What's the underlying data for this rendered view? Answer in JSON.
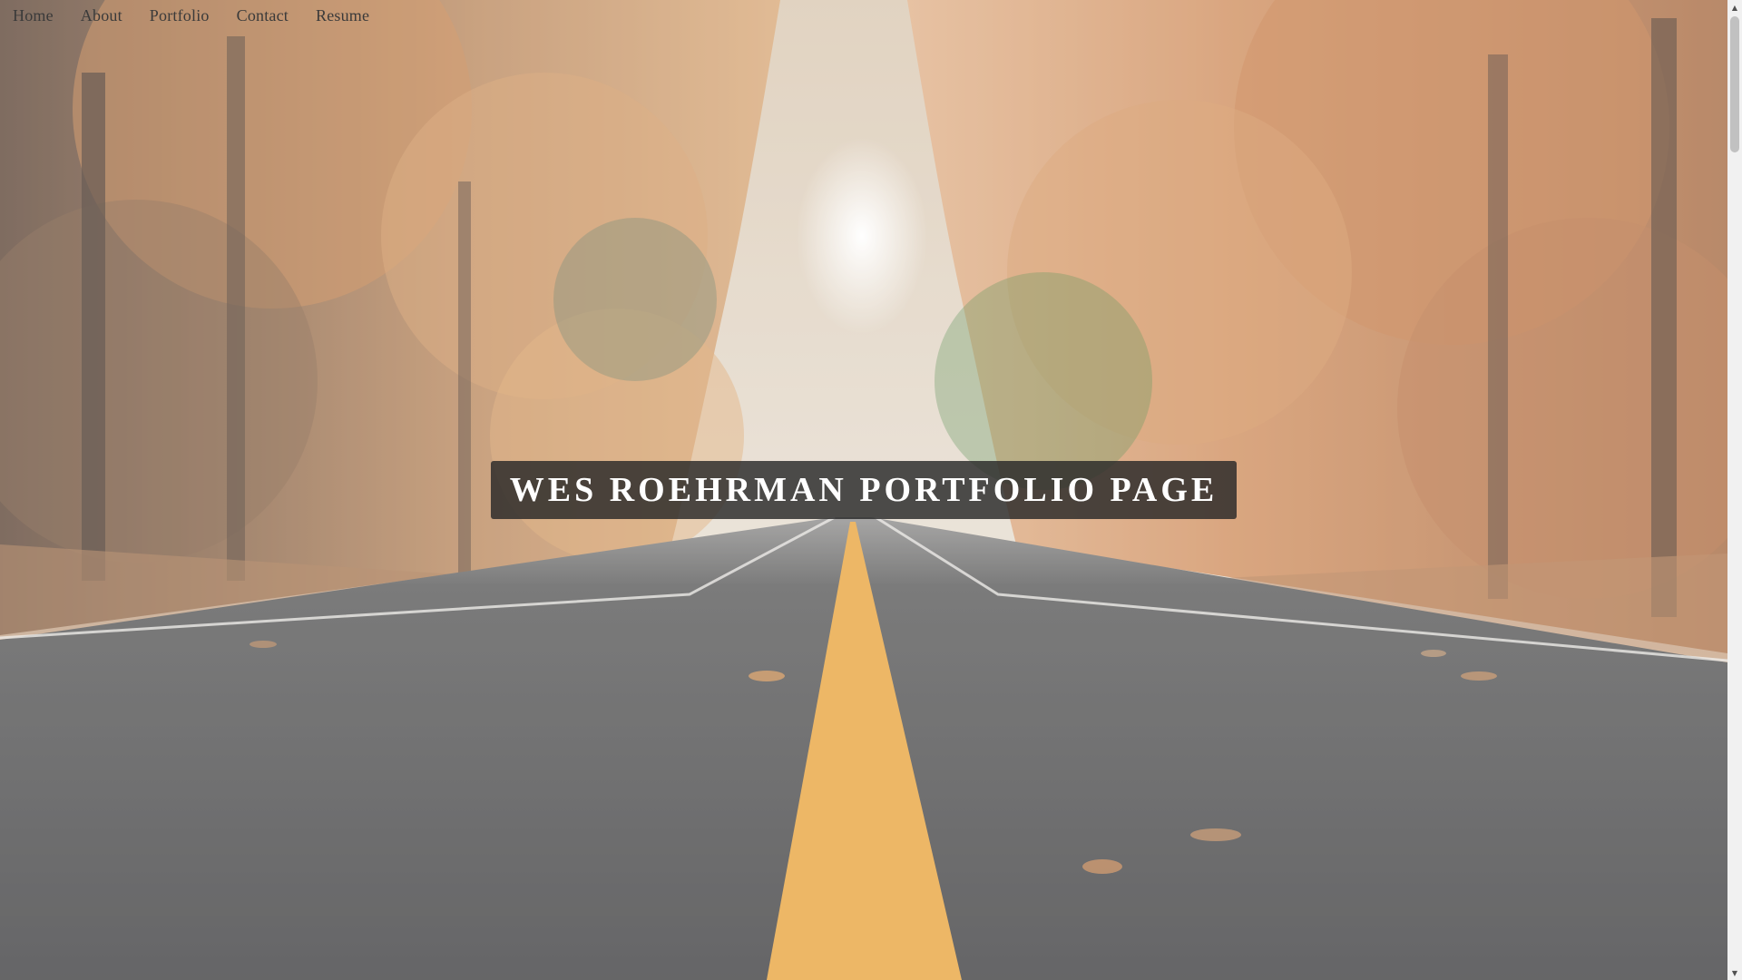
{
  "nav": {
    "items": [
      {
        "label": "Home"
      },
      {
        "label": "About"
      },
      {
        "label": "Portfolio"
      },
      {
        "label": "Contact"
      },
      {
        "label": "Resume"
      }
    ]
  },
  "hero": {
    "title": "WES ROEHRMAN PORTFOLIO PAGE",
    "background": "autumn-forest-road-photo"
  },
  "scrollbar": {
    "up_icon": "▲",
    "down_icon": "▼"
  },
  "colors": {
    "banner_bg": "#282828",
    "title_text": "#ffffff",
    "nav_text": "#3a3a3a",
    "road_line": "#e8a33c",
    "foliage": "#c8844a"
  }
}
